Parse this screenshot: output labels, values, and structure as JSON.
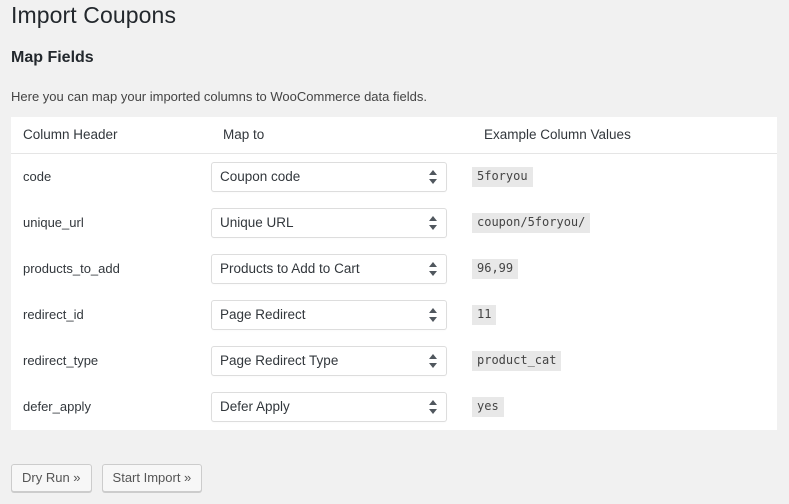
{
  "page": {
    "title": "Import Coupons",
    "section_title": "Map Fields",
    "intro": "Here you can map your imported columns to WooCommerce data fields."
  },
  "table": {
    "columns": [
      {
        "key": "column_header",
        "label": "Column Header"
      },
      {
        "key": "map_to",
        "label": "Map to"
      },
      {
        "key": "example_values",
        "label": "Example Column Values"
      }
    ],
    "rows": [
      {
        "column_header": "code",
        "map_to": "Coupon code",
        "example_values": "5foryou"
      },
      {
        "column_header": "unique_url",
        "map_to": "Unique URL",
        "example_values": "coupon/5foryou/"
      },
      {
        "column_header": "products_to_add",
        "map_to": "Products to Add to Cart",
        "example_values": "96,99"
      },
      {
        "column_header": "redirect_id",
        "map_to": "Page Redirect",
        "example_values": "11"
      },
      {
        "column_header": "redirect_type",
        "map_to": "Page Redirect Type",
        "example_values": "product_cat"
      },
      {
        "column_header": "defer_apply",
        "map_to": "Defer Apply",
        "example_values": "yes"
      }
    ]
  },
  "buttons": {
    "dry_run": "Dry Run »",
    "start_import": "Start Import »"
  },
  "icons": {
    "select_arrows": "updown-arrows-icon"
  },
  "colors": {
    "page_background": "#f1f1f1",
    "panel_background": "#ffffff",
    "text": "#32373c",
    "heading": "#23282d",
    "border": "#e5e5e5",
    "code_background": "#e8e8e8",
    "button_background": "#f7f7f7",
    "button_border": "#cccccc"
  }
}
